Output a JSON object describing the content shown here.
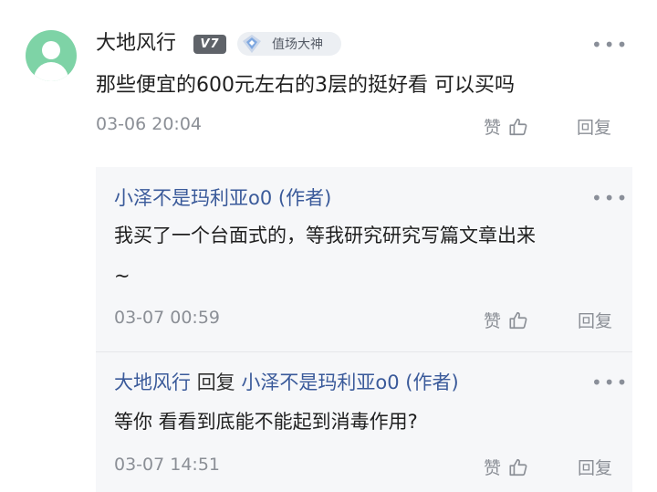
{
  "comment": {
    "username": "大地风行",
    "level_badge": "V7",
    "title_badge": "值场大神",
    "text": "那些便宜的600元左右的3层的挺好看 可以买吗",
    "time": "03-06 20:04",
    "like_label": "赞",
    "reply_label": "回复"
  },
  "replies": [
    {
      "author": "小泽不是玛利亚o0 (作者)",
      "text_line1": "我买了一个台面式的，等我研究研究写篇文章出来",
      "text_line2": "~",
      "time": "03-07 00:59",
      "like_label": "赞",
      "reply_label": "回复"
    },
    {
      "author": "大地风行",
      "reply_word": "回复",
      "reply_to": "小泽不是玛利亚o0 (作者)",
      "text": "等你 看看到底能不能起到消毒作用?",
      "time": "03-07 14:51",
      "like_label": "赞",
      "reply_label": "回复"
    }
  ],
  "icons": {
    "more": "more-icon",
    "like": "thumbs-up-icon",
    "avatar": "default-avatar"
  },
  "colors": {
    "avatar_bg": "#7ed3a6",
    "author_link": "#3a5a9a",
    "meta_gray": "#8b8f96",
    "reply_bg": "#f6f7f9"
  }
}
